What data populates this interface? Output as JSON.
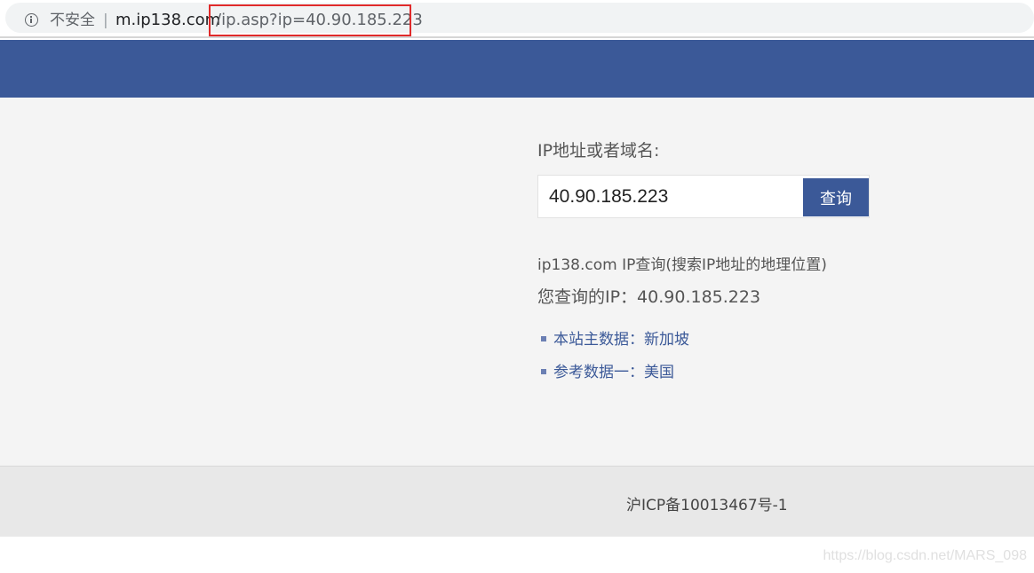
{
  "browser": {
    "security_label": "不安全",
    "separator": "|",
    "url_host": "m.ip138.com",
    "url_path": "/ip.asp?ip=40.90.185.223"
  },
  "search": {
    "label": "IP地址或者域名:",
    "value": "40.90.185.223",
    "button_label": "查询"
  },
  "result": {
    "description": "ip138.com IP查询(搜索IP地址的地理位置)",
    "queried_ip": "您查询的IP：40.90.185.223",
    "items": [
      {
        "text": "本站主数据：新加坡"
      },
      {
        "text": "参考数据一：美国"
      }
    ]
  },
  "footer": {
    "icp": "沪ICP备10013467号-1"
  },
  "watermark": "https://blog.csdn.net/MARS_098",
  "colors": {
    "brand": "#3b5998",
    "highlight": "#e02a2a"
  }
}
